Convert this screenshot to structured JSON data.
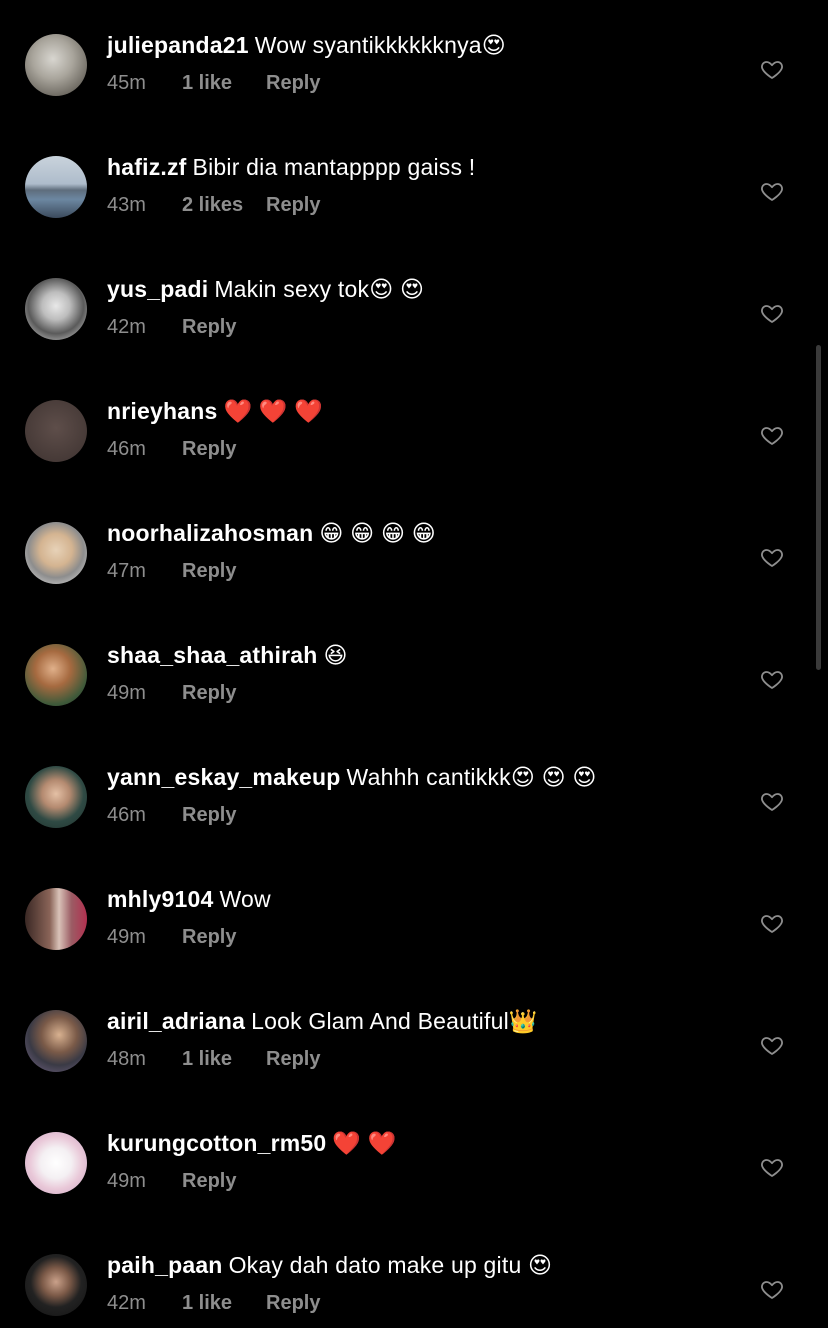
{
  "colors": {
    "background": "#000000",
    "primary_text": "#ffffff",
    "secondary_text": "#8e8e8e"
  },
  "comments": [
    {
      "username": "juliepanda21",
      "text": "Wow syantikkkkkknya😍",
      "time": "45m",
      "likes": "1 like",
      "reply": "Reply",
      "avatar": "grey-cat-photo"
    },
    {
      "username": "hafiz.zf",
      "text": "Bibir dia mantapppp gaiss !",
      "time": "43m",
      "likes": "2 likes",
      "reply": "Reply",
      "avatar": "bridge-photo"
    },
    {
      "username": "yus_padi",
      "text": "Makin sexy tok😍 😍",
      "time": "42m",
      "likes": "",
      "reply": "Reply",
      "avatar": "portrait-photo"
    },
    {
      "username": "nrieyhans",
      "text": "❤️ ❤️ ❤️",
      "time": "46m",
      "likes": "",
      "reply": "Reply",
      "avatar": "bunny-logo"
    },
    {
      "username": "noorhalizahosman",
      "text": "😁 😁 😁 😁",
      "time": "47m",
      "likes": "",
      "reply": "Reply",
      "avatar": "hijab-woman-photo"
    },
    {
      "username": "shaa_shaa_athirah",
      "text": "😆",
      "time": "49m",
      "likes": "",
      "reply": "Reply",
      "avatar": "child-photo"
    },
    {
      "username": "yann_eskay_makeup",
      "text": "Wahhh cantikkk😍 😍 😍",
      "time": "46m",
      "likes": "",
      "reply": "Reply",
      "avatar": "green-hijab-photo"
    },
    {
      "username": "mhly9104",
      "text": "Wow",
      "time": "49m",
      "likes": "",
      "reply": "Reply",
      "avatar": "man-photo"
    },
    {
      "username": "airil_adriana",
      "text": "Look Glam And Beautiful👑",
      "time": "48m",
      "likes": "1 like",
      "reply": "Reply",
      "avatar": "selfie-photo"
    },
    {
      "username": "kurungcotton_rm50",
      "text": "❤️ ❤️",
      "time": "49m",
      "likes": "",
      "reply": "Reply",
      "avatar": "floral-logo"
    },
    {
      "username": "paih_paan",
      "text": "Okay dah dato make up gitu 😍",
      "time": "42m",
      "likes": "1 like",
      "reply": "Reply",
      "avatar": "sunglasses-photo"
    }
  ]
}
